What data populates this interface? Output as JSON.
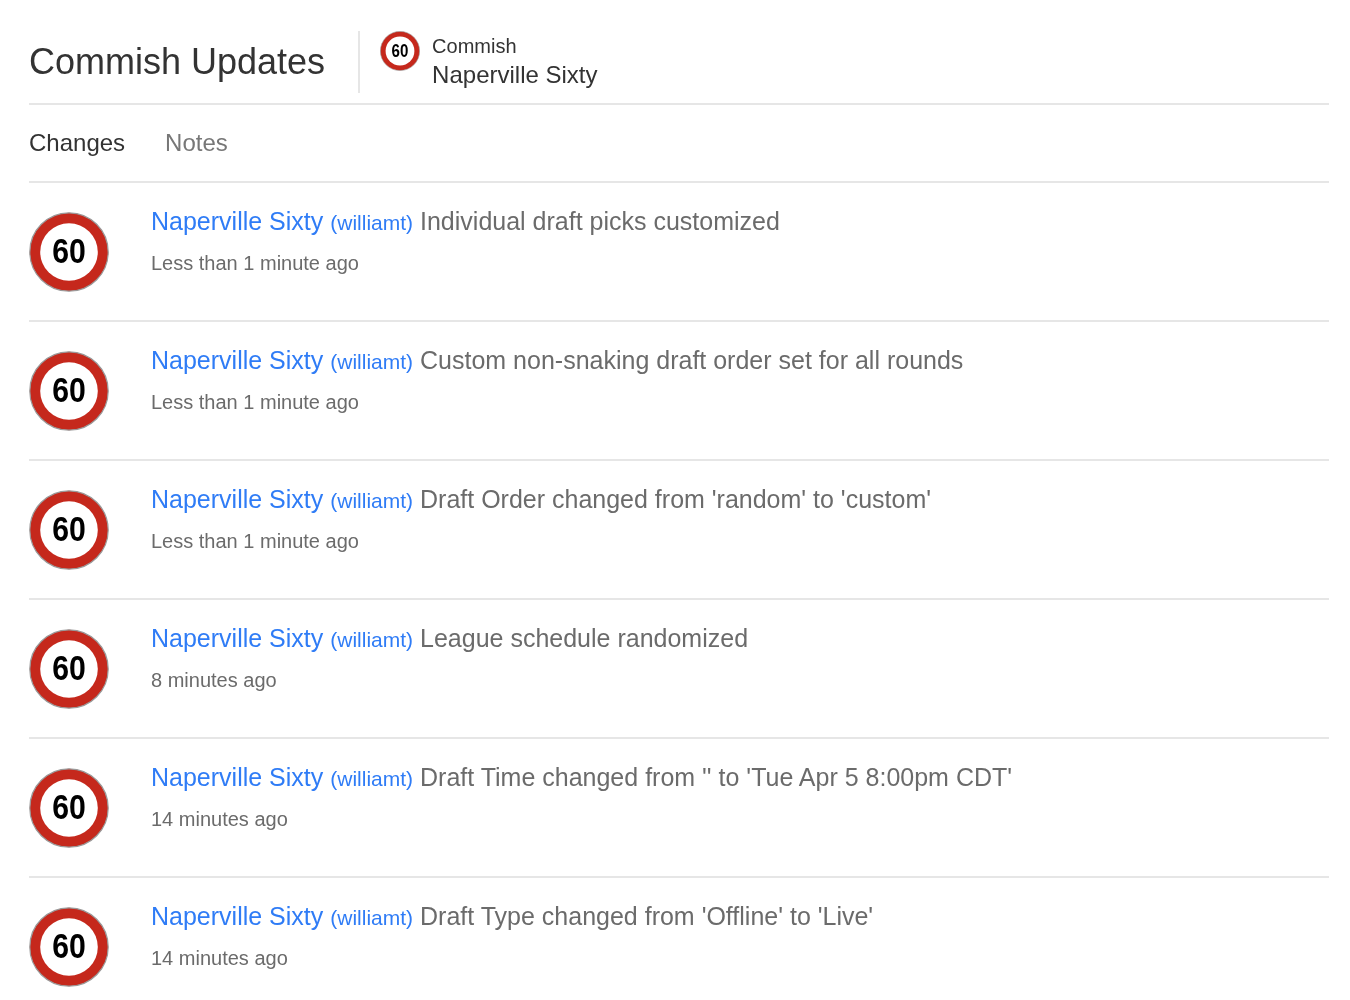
{
  "header": {
    "title": "Commish Updates",
    "league": {
      "logo_text": "60",
      "label": "Commish",
      "name": "Naperville Sixty"
    }
  },
  "tabs": [
    {
      "label": "Changes",
      "selected": true
    },
    {
      "label": "Notes",
      "selected": false
    }
  ],
  "updates": [
    {
      "logo_text": "60",
      "team": "Naperville Sixty",
      "user": "(williamt)",
      "description": "Individual draft picks customized",
      "time": "Less than 1 minute ago"
    },
    {
      "logo_text": "60",
      "team": "Naperville Sixty",
      "user": "(williamt)",
      "description": "Custom non-snaking draft order set for all rounds",
      "time": "Less than 1 minute ago"
    },
    {
      "logo_text": "60",
      "team": "Naperville Sixty",
      "user": "(williamt)",
      "description": "Draft Order changed from 'random' to 'custom'",
      "time": "Less than 1 minute ago"
    },
    {
      "logo_text": "60",
      "team": "Naperville Sixty",
      "user": "(williamt)",
      "description": "League schedule randomized",
      "time": "8 minutes ago"
    },
    {
      "logo_text": "60",
      "team": "Naperville Sixty",
      "user": "(williamt)",
      "description": "Draft Time changed from '' to 'Tue Apr 5 8:00pm CDT'",
      "time": "14 minutes ago"
    },
    {
      "logo_text": "60",
      "team": "Naperville Sixty",
      "user": "(williamt)",
      "description": "Draft Type changed from 'Offline' to 'Live'",
      "time": "14 minutes ago"
    }
  ]
}
